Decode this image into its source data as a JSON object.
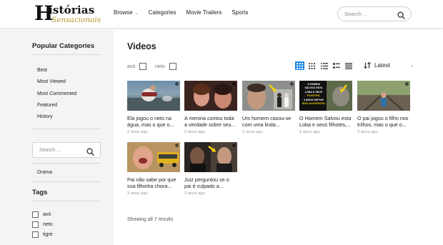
{
  "logo": {
    "h": "H",
    "line1": "istórias",
    "line2": "Sensacionais"
  },
  "nav": {
    "browse": "Browse",
    "categories": "Categories",
    "trailers": "Movie Trailers",
    "sports": "Sports"
  },
  "header_search": {
    "placeholder": "Search ..."
  },
  "sidebar": {
    "popular_title": "Popular Categories",
    "links": [
      "Best",
      "Most Viewed",
      "Most Commented",
      "Featured",
      "History"
    ],
    "search_placeholder": "Search ...",
    "drama": "Drama",
    "tags_title": "Tags",
    "tags": [
      "avó",
      "neto",
      "tigre"
    ]
  },
  "main": {
    "title": "Videos",
    "filters": [
      "avó",
      "neto"
    ],
    "sort_label": "Latest",
    "results": "Showing all 7 results"
  },
  "videos": [
    {
      "title": "Ela jogou o neto na água, mas o que o...",
      "date": "2 anos ago"
    },
    {
      "title": "A menina contou toda a verdade sobre seu...",
      "date": "2 anos ago"
    },
    {
      "title": "Um homem casou-se com uma linda...",
      "date": "2 anos ago"
    },
    {
      "title": "O Homem Salvou esta Loba e seus filhotes,...",
      "date": "3 anos ago",
      "thumb_text": [
        "O HOMEM",
        "SALVOU ESTA",
        "LOBA E SEUS",
        "FILHOTES.",
        "4 ANOS DEPOIS",
        "ISSO ACONTECEU"
      ]
    },
    {
      "title": "O pai jogou o filho nos trilhos, mas o que o...",
      "date": "3 anos ago"
    },
    {
      "title": "Pai não sabe por que sua filhinha chora...",
      "date": "3 anos ago"
    },
    {
      "title": "Juiz perguntou se o pai é culpado a...",
      "date": "3 anos ago"
    }
  ],
  "colors": {
    "accent": "#1e88e5",
    "sidebar_bg": "#f4f4f4",
    "logo_gold": "#b9962c"
  }
}
